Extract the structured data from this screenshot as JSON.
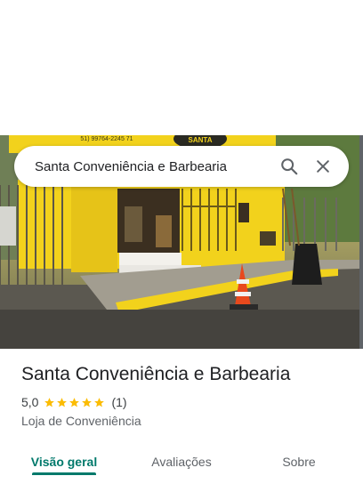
{
  "photo": {
    "sign_brand": "SANTA",
    "sign_phone": "51) 99764-2245 71"
  },
  "search": {
    "query": "Santa Conveniência e Barbearia",
    "search_icon": "search-icon",
    "close_icon": "close-icon"
  },
  "place": {
    "name": "Santa Conveniência e Barbearia",
    "rating": "5,0",
    "stars": 5,
    "review_count": "(1)",
    "category": "Loja de Conveniência"
  },
  "tabs": [
    {
      "label": "Visão geral",
      "active": true
    },
    {
      "label": "Avaliações",
      "active": false
    },
    {
      "label": "Sobre",
      "active": false
    }
  ],
  "colors": {
    "accent": "#00796b",
    "star": "#fbbc04",
    "storefront_yellow": "#f2d21c"
  }
}
